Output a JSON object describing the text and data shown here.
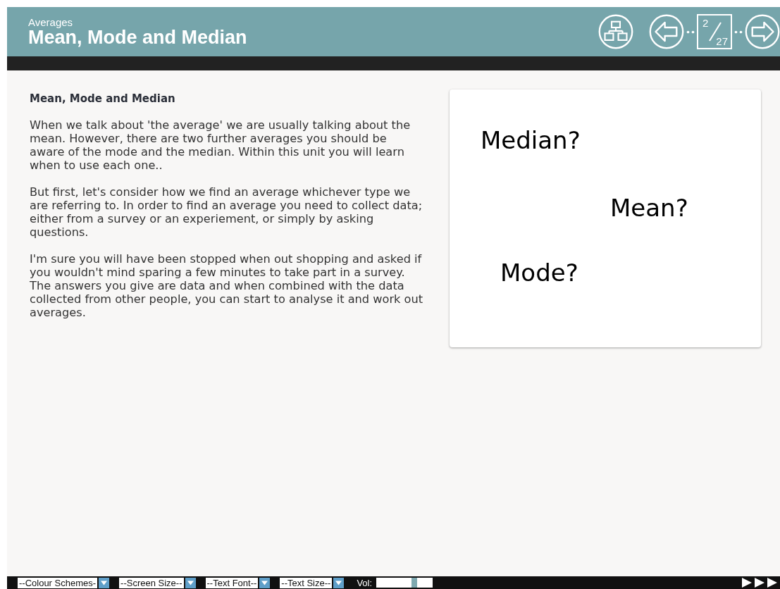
{
  "header": {
    "subtitle": "Averages",
    "title": "Mean, Mode and Median",
    "page": {
      "current": "2",
      "total": "27"
    }
  },
  "content": {
    "heading": "Mean, Mode and Median",
    "paragraphs": [
      "When we talk about 'the average' we are usually talking about the mean. However, there are two further averages you should be aware of the mode and the median.  Within this unit you will learn when to use each one..",
      "But first, let's consider how we find an average whichever type we are referring to. In order to find an average you need to collect data; either from a survey or an experiement, or simply by asking questions.",
      "I'm sure you will have been stopped when out shopping and asked if you wouldn't mind sparing a few minutes to take part in a survey. The answers you give are data and when combined with the data collected from other people, you can start to analyse it and work out averages."
    ]
  },
  "card": {
    "words": [
      "Median?",
      "Mean?",
      "Mode?"
    ]
  },
  "toolbar": {
    "dropdowns": [
      "--Colour Schemes-",
      "--Screen Size--",
      "--Text Font--",
      "--Text Size--"
    ],
    "volume": {
      "label": "Vol:",
      "level": 0.68
    }
  }
}
